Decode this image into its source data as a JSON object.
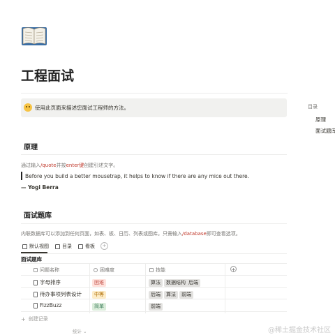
{
  "page": {
    "title": "工程面试"
  },
  "callout": {
    "text": "使用此页面来描述您面试工程师的方法。"
  },
  "toc": {
    "title": "目录",
    "items": [
      "原理",
      "面试题库"
    ]
  },
  "section_principle": {
    "heading": "原理",
    "hint_pre": "通过输入",
    "hint_code1": "/quote",
    "hint_mid": "并按",
    "hint_code2": "enter键",
    "hint_post": "创建引述文字。",
    "quote": "Before you build a better mousetrap, it helps to know if there are any mice out there.",
    "author": "— Yogi Berra"
  },
  "section_bank": {
    "heading": "面试题库",
    "hint_pre": "内联数据库可以添加到任何页面，如表、板、日历、列表或图库。只需输入",
    "hint_code": "/database",
    "hint_post": "即可查看选项。"
  },
  "views": {
    "tabs": [
      "默认视图",
      "目录",
      "看板"
    ],
    "add": "+"
  },
  "database": {
    "title": "面试题库",
    "columns": [
      "问题名称",
      "困难度",
      "技能"
    ],
    "add_column": "+",
    "rows": [
      {
        "name": "字母排序",
        "difficulty": "困难",
        "difficulty_color": "red",
        "skills": [
          "算法",
          "数据结构",
          "后端"
        ]
      },
      {
        "name": "待办事项列表设计",
        "difficulty": "中等",
        "difficulty_color": "yellow",
        "skills": [
          "后端",
          "算法",
          "前端"
        ]
      },
      {
        "name": "FizzBuzz",
        "difficulty": "简单",
        "difficulty_color": "green",
        "skills": [
          "前端"
        ]
      }
    ],
    "new_record": "创建记录",
    "calculate": "统计 ⌄"
  },
  "watermark": "@稀土掘金技术社区",
  "colors": {
    "accent_code": "#c0392b",
    "tag_red": "#ffe2dd",
    "tag_yellow": "#fdecc8",
    "tag_green": "#dbeddb",
    "tag_gray": "#e3e2e0"
  },
  "icons": {
    "page": "open-book-icon",
    "callout": "grinning-face-icon",
    "row": "page-doc-icon"
  }
}
